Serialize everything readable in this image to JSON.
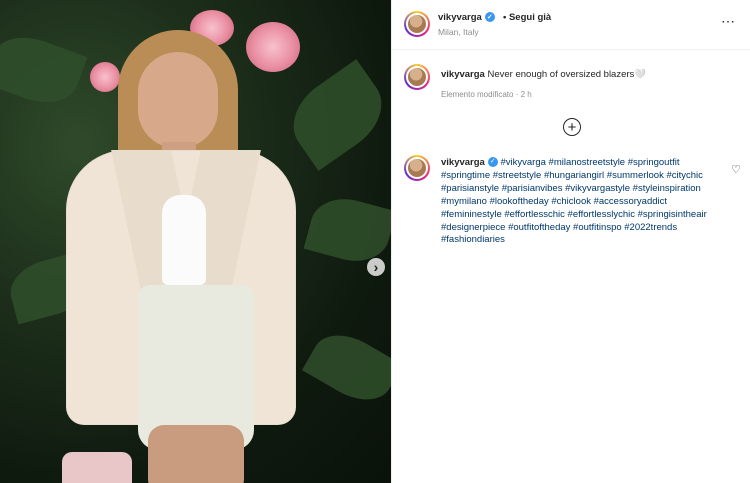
{
  "post": {
    "username": "vikyvarga",
    "follow_status": "Segui già",
    "location": "Milan, Italy",
    "more_icon": "⋯"
  },
  "caption": {
    "username": "vikyvarga",
    "text": "Never enough of oversized blazers",
    "emoji": "🤍",
    "edited_label": "Elemento modificato",
    "time_ago": "2 h"
  },
  "load_more_icon": "+",
  "comment": {
    "username": "vikyvarga",
    "hashtags": "#vikyvarga #milanostreetstyle #springoutfit #springtime #streetstyle #hungariangirl #summerlook #citychic #parisianstyle #parisianvibes #vikyvargastyle #styleinspiration #mymilano #lookoftheday #chiclook #accessoryaddict #femininestyle #effortlesschic #effortlesslychic #springisintheair #designerpiece #outfitoftheday #outfitinspo #2022trends #fashiondiaries",
    "like_icon": "♡"
  },
  "media": {
    "next_icon": "›"
  },
  "colors": {
    "link": "#00376b",
    "verified": "#3897f0",
    "muted": "#8e8e8e"
  }
}
